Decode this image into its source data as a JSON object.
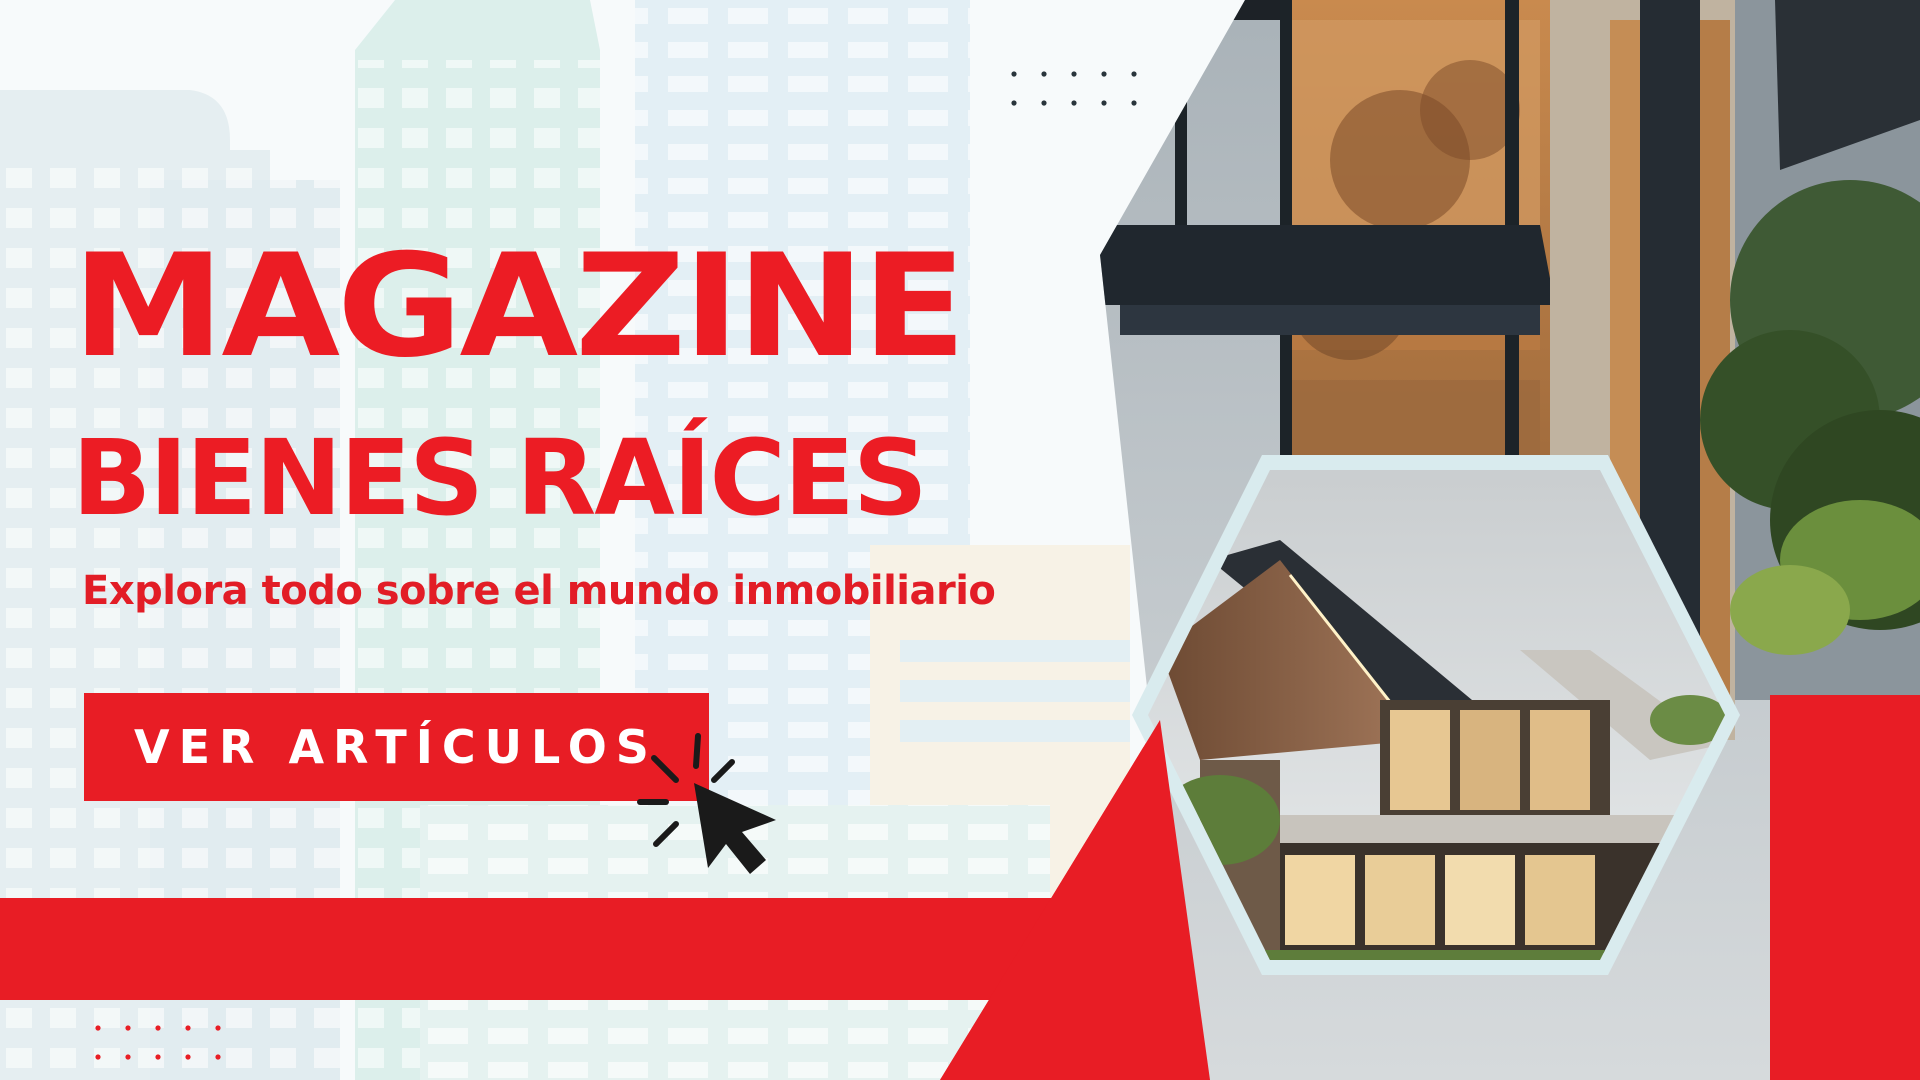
{
  "hero": {
    "title_line1": "MAGAZINE",
    "title_line2": "BIENES RAÍCES",
    "subtitle": "Explora todo sobre el mundo inmobiliario",
    "cta_label": "VER ARTÍCULOS"
  },
  "icons": {
    "cursor": "cursor-click-icon",
    "dots": "dot-grid-icon"
  },
  "colors": {
    "brand_red": "#e81d25",
    "text_white": "#ffffff",
    "background": "#f3f8f9",
    "dark": "#1a1a1a"
  }
}
